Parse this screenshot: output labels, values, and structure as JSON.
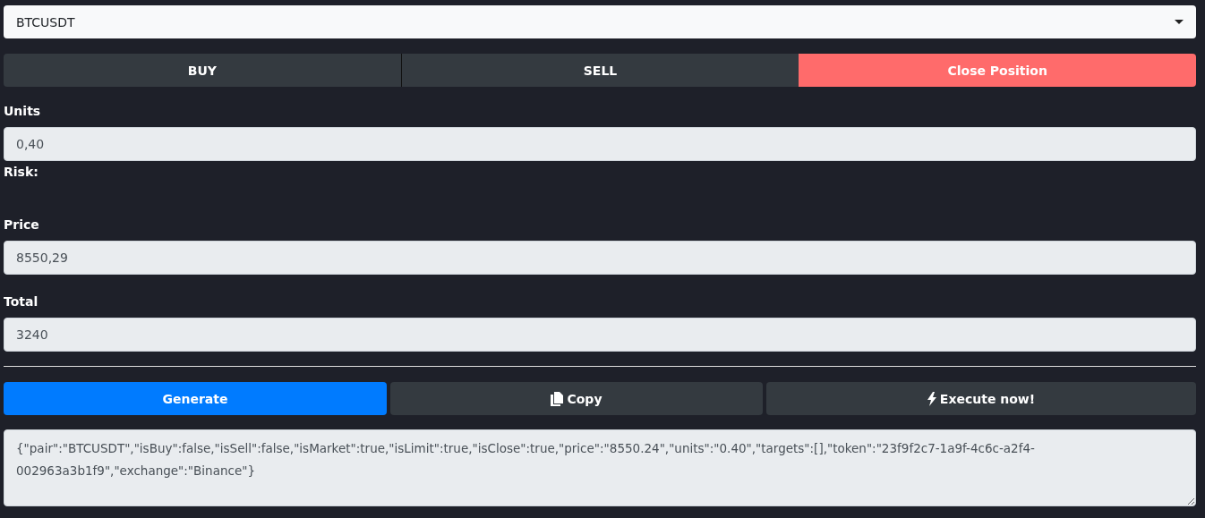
{
  "pair_select": {
    "value": "BTCUSDT"
  },
  "side_buttons": [
    {
      "label": "BUY",
      "kind": "toggle",
      "selected": false
    },
    {
      "label": "SELL",
      "kind": "toggle",
      "selected": false
    },
    {
      "label": "Close Position",
      "kind": "danger"
    }
  ],
  "fields": [
    {
      "label": "Units",
      "value": "0,40",
      "note": "Risk:"
    },
    {
      "label": "Price",
      "value": "8550,29"
    },
    {
      "label": "Total",
      "value": "3240"
    }
  ],
  "action_buttons": [
    {
      "label": "Generate",
      "kind": "primary"
    },
    {
      "label": "Copy",
      "kind": "copy"
    },
    {
      "label": "Execute now!",
      "kind": "execute"
    }
  ],
  "output": {
    "value": "{\"pair\":\"BTCUSDT\",\"isBuy\":false,\"isSell\":false,\"isMarket\":true,\"isLimit\":true,\"isClose\":true,\"price\":\"8550.24\",\"units\":\"0.40\",\"targets\":[],\"token\":\"23f9f2c7-1a9f-4c6c-a2f4-002963a3b1f9\",\"exchange\":\"Binance\"}"
  }
}
